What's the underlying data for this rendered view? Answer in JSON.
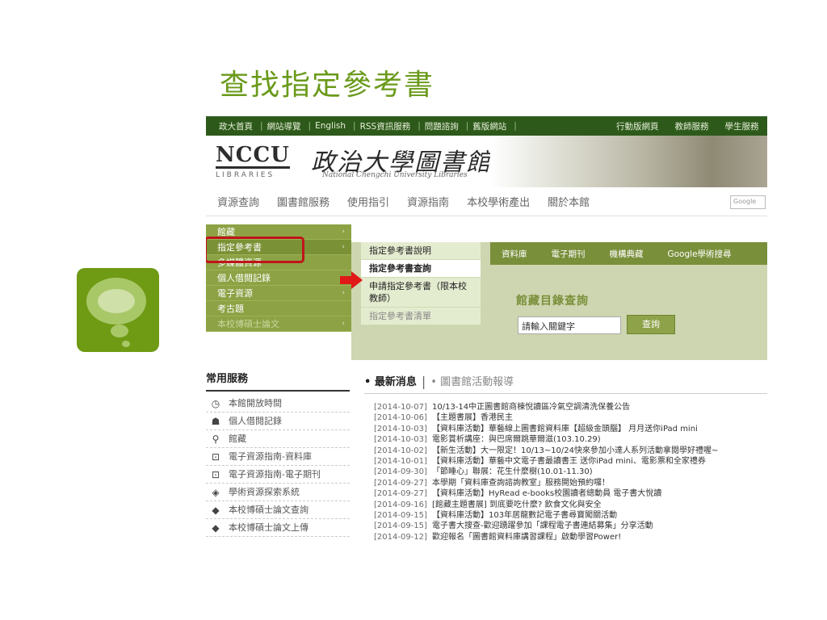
{
  "slide": {
    "title": "查找指定參考書"
  },
  "topbar": {
    "left": [
      "政大首頁",
      "網站導覽",
      "English",
      "RSS資訊服務",
      "問題諮詢",
      "舊版網站"
    ],
    "right": [
      "行動版網頁",
      "教師服務",
      "學生服務"
    ]
  },
  "brand": {
    "nccu": "NCCU",
    "libraries": "LIBRARIES",
    "chinese": "政治大學圖書館",
    "english": "National Chengchi University Libraries"
  },
  "mainnav": {
    "items": [
      "資源查詢",
      "圖書館服務",
      "使用指引",
      "資源指南",
      "本校學術產出",
      "關於本館"
    ],
    "google": "Google"
  },
  "leftmenu": {
    "items": [
      "館藏",
      "指定參考書",
      "多媒體資源",
      "個人借閱記錄",
      "電子資源",
      "考古題",
      "本校博碩士論文"
    ]
  },
  "submenu": {
    "items": [
      "指定參考書說明",
      "指定參考書查詢",
      "申請指定參考書（限本校教師）",
      "指定參考書清單"
    ]
  },
  "search": {
    "tabs": [
      "資料庫",
      "電子期刊",
      "機構典藏",
      "Google學術搜尋"
    ],
    "title": "館藏目錄查詢",
    "placeholder": "請輸入關鍵字",
    "button": "查詢"
  },
  "services": {
    "title": "常用服務",
    "items": [
      {
        "label": "本館開放時間",
        "icon": "clock-icon"
      },
      {
        "label": "個人借閱記錄",
        "icon": "person-icon"
      },
      {
        "label": "館藏",
        "icon": "search-icon"
      },
      {
        "label": "電子資源指南-資料庫",
        "icon": "magnifier-doc-icon"
      },
      {
        "label": "電子資源指南-電子期刊",
        "icon": "magnifier-doc-icon"
      },
      {
        "label": "學術資源探索系統",
        "icon": "box-icon"
      },
      {
        "label": "本校博碩士論文查詢",
        "icon": "graduation-cap-icon"
      },
      {
        "label": "本校博碩士論文上傳",
        "icon": "graduation-cap-icon"
      }
    ]
  },
  "news": {
    "tab_active": "最新消息",
    "tab_other": "圖書館活動報導",
    "items": [
      {
        "date": "[2014-10-07]",
        "title": "10/13-14中正圖書館商棟悅讀區冷氣空調清洗保養公告"
      },
      {
        "date": "[2014-10-06]",
        "title": "【主題書展】香港民主"
      },
      {
        "date": "[2014-10-03]",
        "title": "【資料庫活動】華藝線上圖書館資料庫【超級金頭腦】 月月送你iPad mini"
      },
      {
        "date": "[2014-10-03]",
        "title": "電影賞析講座：與巴席爾跳華爾滋(103.10.29)"
      },
      {
        "date": "[2014-10-02]",
        "title": "【新生活動】大一限定！10/13~10/24快來參加小達人系列活動拿閱學好禮喔~"
      },
      {
        "date": "[2014-10-01]",
        "title": "【資料庫活動】華藝中文電子書最讀書王 送你iPad mini、電影票和全家禮券"
      },
      {
        "date": "[2014-09-30]",
        "title": "「節睡心」聯展：花生什麼樹(10.01-11.30)"
      },
      {
        "date": "[2014-09-27]",
        "title": "本學期「資料庫查詢諮詢教室」服務開始預約囉！"
      },
      {
        "date": "[2014-09-27]",
        "title": "【資料庫活動】HyRead e-books校園讀者總動員 電子書大悅讀"
      },
      {
        "date": "[2014-09-16]",
        "title": "[館藏主題書展] 到底要吃什麼? 飲食文化與安全"
      },
      {
        "date": "[2014-09-15]",
        "title": "【資料庫活動】103年居龍數記電子書尋寶闖關活動"
      },
      {
        "date": "[2014-09-15]",
        "title": "電子書大搜查-歡迎踴躍參加「課程電子書連結募集」分享活動"
      },
      {
        "date": "[2014-09-12]",
        "title": "歡迎報名「圖書館資料庫講習課程」啟動學習Power!"
      }
    ]
  },
  "colors": {
    "title_green": "#6a9a1a",
    "topbar": "#2d5a1b",
    "menu_green": "#8ca244",
    "highlight_red": "#c0141a",
    "arrow_red": "#e01818"
  }
}
